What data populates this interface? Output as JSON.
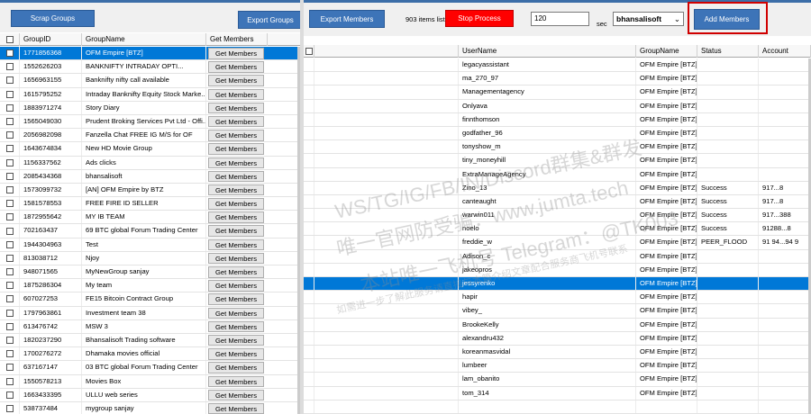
{
  "left": {
    "scrap_label": "Scrap Groups",
    "export_label": "Export Groups",
    "columns": [
      "GroupID",
      "GroupName",
      "Get Members"
    ],
    "get_label": "Get Members",
    "rows": [
      {
        "id": "1771856368",
        "name": "OFM Empire [BTZ]",
        "selected": true
      },
      {
        "id": "1552626203",
        "name": "BANKNIFTY INTRADAY OPTI..."
      },
      {
        "id": "1656963155",
        "name": "Banknifty nifty call available"
      },
      {
        "id": "1615795252",
        "name": "Intraday Banknifty Equity Stock Marke..."
      },
      {
        "id": "1883971274",
        "name": "Story Diary"
      },
      {
        "id": "1565049030",
        "name": "Prudent Broking Services Pvt Ltd - Offi..."
      },
      {
        "id": "2056982098",
        "name": "Fanzella Chat FREE IG M/S for OF"
      },
      {
        "id": "1643674834",
        "name": "New HD Movie Group"
      },
      {
        "id": "1156337562",
        "name": "Ads clicks"
      },
      {
        "id": "2085434368",
        "name": "bhansalisoft"
      },
      {
        "id": "1573099732",
        "name": "[AN] OFM Empire by BTZ"
      },
      {
        "id": "1581578553",
        "name": "FREE FIRE ID SELLER"
      },
      {
        "id": "1872955642",
        "name": "MY IB TEAM"
      },
      {
        "id": "702163437",
        "name": "69 BTC global Forum Trading Center"
      },
      {
        "id": "1944304963",
        "name": "Test"
      },
      {
        "id": "813038712",
        "name": "Njoy"
      },
      {
        "id": "948071565",
        "name": "MyNewGroup sanjay"
      },
      {
        "id": "1875286304",
        "name": "My team"
      },
      {
        "id": "607027253",
        "name": "FE15 Bitcoin Contract Group"
      },
      {
        "id": "1797963861",
        "name": "Investment team 38"
      },
      {
        "id": "613476742",
        "name": "MSW 3"
      },
      {
        "id": "1820237290",
        "name": "Bhansalisoft Trading software"
      },
      {
        "id": "1700276272",
        "name": "Dhamaka movies official"
      },
      {
        "id": "637167147",
        "name": "03 BTC global Forum Trading Center"
      },
      {
        "id": "1550578213",
        "name": "Movies Box"
      },
      {
        "id": "1663433395",
        "name": "ULLU web series"
      },
      {
        "id": "538737484",
        "name": "mygroup sanjay"
      }
    ]
  },
  "right": {
    "export_label": "Export Members",
    "items_text": "903 items listed",
    "stop_label": "Stop Process",
    "delay_value": "120",
    "sec_label": "sec",
    "account_value": "bhansalisoft",
    "add_label": "Add Members",
    "columns": [
      "UserName",
      "GroupName",
      "Status",
      "Account"
    ],
    "rows": [
      {
        "user": "legacyassistant",
        "group": "OFM Empire [BTZ]",
        "status": "",
        "account": ""
      },
      {
        "user": "ma_270_97",
        "group": "OFM Empire [BTZ]",
        "status": "",
        "account": ""
      },
      {
        "user": "Managementagency",
        "group": "OFM Empire [BTZ]",
        "status": "",
        "account": ""
      },
      {
        "user": "Onlyava",
        "group": "OFM Empire [BTZ]",
        "status": "",
        "account": ""
      },
      {
        "user": "finnthomson",
        "group": "OFM Empire [BTZ]",
        "status": "",
        "account": ""
      },
      {
        "user": "godfather_96",
        "group": "OFM Empire [BTZ]",
        "status": "",
        "account": ""
      },
      {
        "user": "tonyshow_m",
        "group": "OFM Empire [BTZ]",
        "status": "",
        "account": ""
      },
      {
        "user": "tiny_moneyhill",
        "group": "OFM Empire [BTZ]",
        "status": "",
        "account": ""
      },
      {
        "user": "ExtraManageAgency",
        "group": "OFM Empire [BTZ]",
        "status": "",
        "account": ""
      },
      {
        "user": "Zino_13",
        "group": "OFM Empire [BTZ]",
        "status": "Success",
        "account": "917...8"
      },
      {
        "user": "canteaught",
        "group": "OFM Empire [BTZ]",
        "status": "Success",
        "account": "917...8"
      },
      {
        "user": "warwin011",
        "group": "OFM Empire [BTZ]",
        "status": "Success",
        "account": "917...388"
      },
      {
        "user": "noelo",
        "group": "OFM Empire [BTZ]",
        "status": "Success",
        "account": "91288...8"
      },
      {
        "user": "freddie_w",
        "group": "OFM Empire [BTZ]",
        "status": "PEER_FLOOD",
        "account": "91 94...94 9"
      },
      {
        "user": "Adison_c",
        "group": "OFM Empire [BTZ]",
        "status": "",
        "account": ""
      },
      {
        "user": "jakeopros",
        "group": "OFM Empire [BTZ]",
        "status": "",
        "account": ""
      },
      {
        "user": "jessyrenko",
        "group": "OFM Empire [BTZ]",
        "status": "",
        "account": "",
        "selected": true
      },
      {
        "user": "hapir",
        "group": "OFM Empire [BTZ]",
        "status": "",
        "account": ""
      },
      {
        "user": "vibey_",
        "group": "OFM Empire [BTZ]",
        "status": "",
        "account": ""
      },
      {
        "user": "BrookeKelly",
        "group": "OFM Empire [BTZ]",
        "status": "",
        "account": ""
      },
      {
        "user": "alexandru432",
        "group": "OFM Empire [BTZ]",
        "status": "",
        "account": ""
      },
      {
        "user": "koreanmasvidal",
        "group": "OFM Empire [BTZ]",
        "status": "",
        "account": ""
      },
      {
        "user": "lumbeer",
        "group": "OFM Empire [BTZ]",
        "status": "",
        "account": ""
      },
      {
        "user": "lam_obanito",
        "group": "OFM Empire [BTZ]",
        "status": "",
        "account": ""
      },
      {
        "user": "tom_314",
        "group": "OFM Empire [BTZ]",
        "status": "",
        "account": ""
      },
      {
        "user": "",
        "group": "",
        "status": "",
        "account": ""
      }
    ]
  },
  "watermark": [
    "WS/TG/IG/FB/IN/Discord群集&群发",
    "唯一官网防受骗：www.jumta.tech",
    "本站唯一飞机号 Telegram：@TK003",
    "如需进一步了解此服务请直接与本篇介绍文章配合服务商飞机号联系"
  ],
  "colors": {
    "accent": "#3d74b8",
    "stop": "#ff0000",
    "selection": "#0078d7",
    "highlight": "#d00000"
  }
}
